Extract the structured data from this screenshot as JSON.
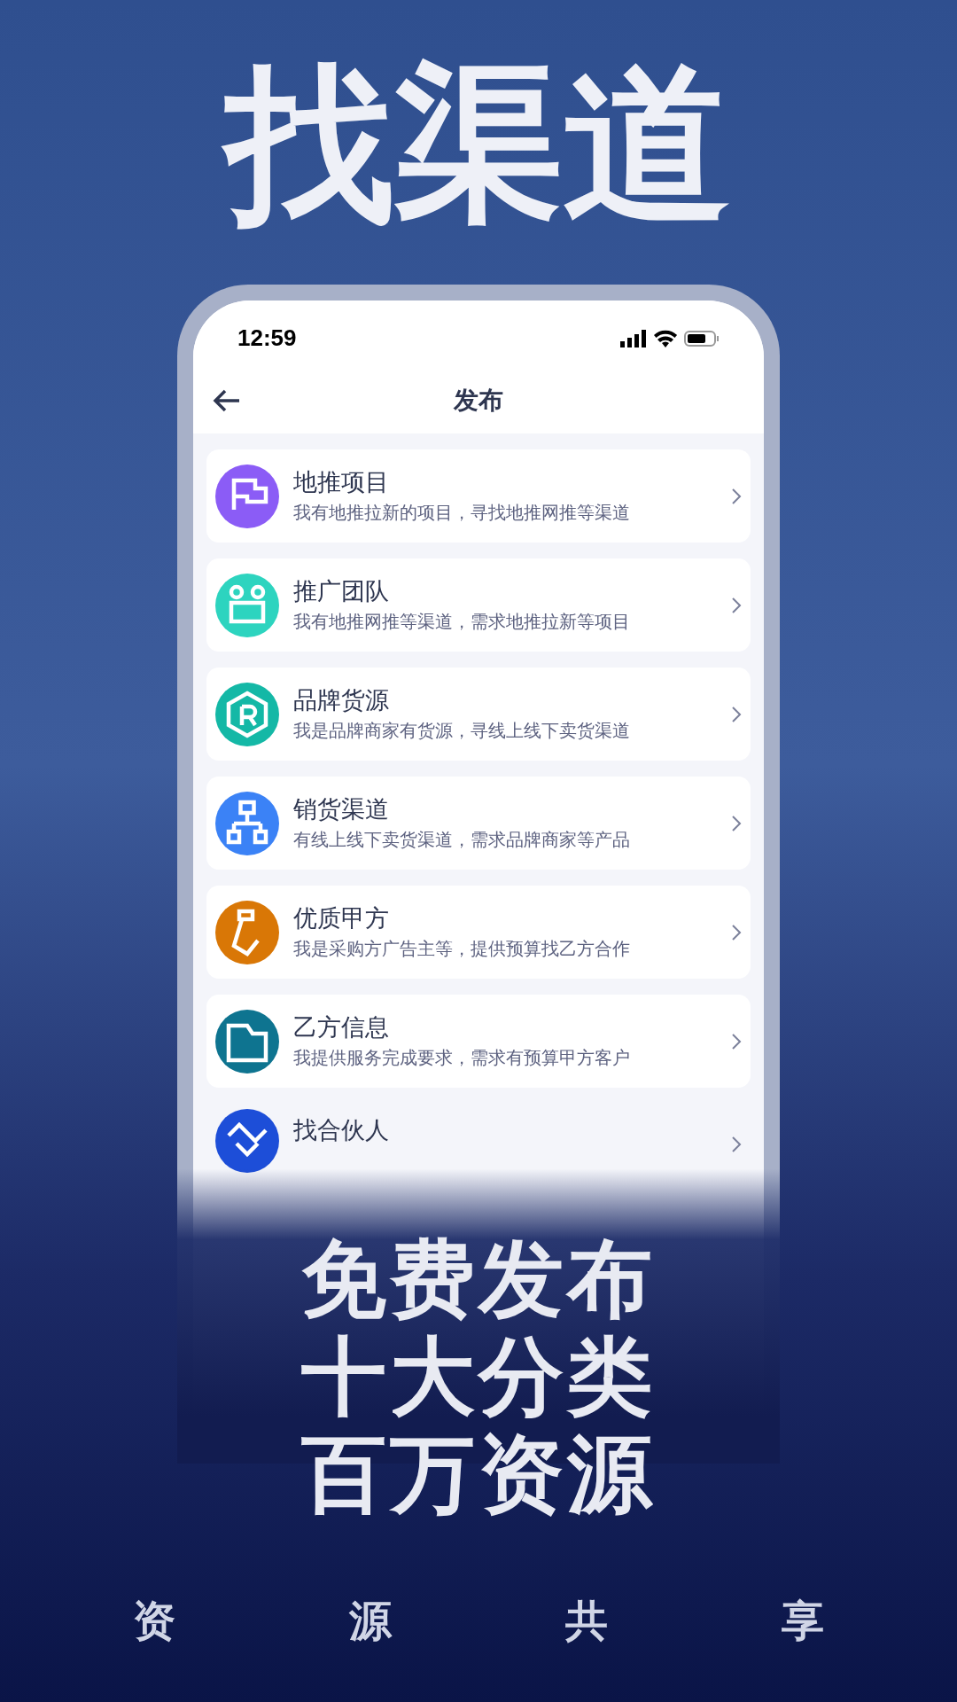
{
  "headline": "找渠道",
  "phone": {
    "status_bar": {
      "time": "12:59"
    },
    "nav": {
      "title": "发布"
    },
    "items": [
      {
        "title": "地推项目",
        "subtitle": "我有地推拉新的项目，寻找地推网推等渠道",
        "color": "#8b5cf6"
      },
      {
        "title": "推广团队",
        "subtitle": "我有地推网推等渠道，需求地推拉新等项目",
        "color": "#2dd4bf"
      },
      {
        "title": "品牌货源",
        "subtitle": "我是品牌商家有货源，寻线上线下卖货渠道",
        "color": "#14b8a6"
      },
      {
        "title": "销货渠道",
        "subtitle": "有线上线下卖货渠道，需求品牌商家等产品",
        "color": "#3b82f6"
      },
      {
        "title": "优质甲方",
        "subtitle": "我是采购方广告主等，提供预算找乙方合作",
        "color": "#d97706"
      },
      {
        "title": "乙方信息",
        "subtitle": "我提供服务完成要求，需求有预算甲方客户",
        "color": "#0e7490"
      },
      {
        "title": "找合伙人",
        "color": "#1d4ed8"
      }
    ]
  },
  "slogans": [
    "免费发布",
    "十大分类",
    "百万资源"
  ],
  "footer": [
    "资",
    "源",
    "共",
    "享"
  ]
}
